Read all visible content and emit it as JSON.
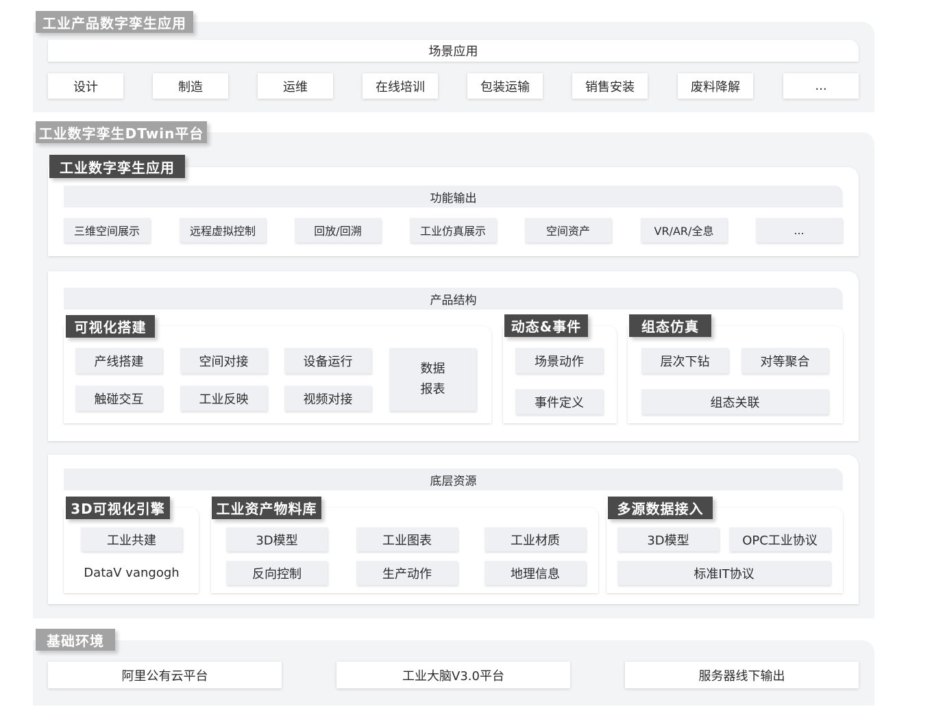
{
  "s1": {
    "title": "工业产品数字孪生应用",
    "bar": "场景应用",
    "items": [
      "设计",
      "制造",
      "运维",
      "在线培训",
      "包装运输",
      "销售安装",
      "废料降解",
      "..."
    ]
  },
  "s2": {
    "title": "工业数字孪生DTwin平台",
    "app_title": "工业数字孪生应用",
    "func": {
      "bar": "功能输出",
      "items": [
        "三维空间展示",
        "远程虚拟控制",
        "回放/回溯",
        "工业仿真展示",
        "空间资产",
        "VR/AR/全息",
        "..."
      ]
    },
    "prod": {
      "bar": "产品结构",
      "vis": {
        "title": "可视化搭建",
        "items": [
          "产线搭建",
          "空间对接",
          "设备运行",
          "触碰交互",
          "工业反映",
          "视频对接"
        ],
        "report_line1": "数据",
        "report_line2": "报表"
      },
      "dyn": {
        "title": "动态&事件",
        "items": [
          "场景动作",
          "事件定义"
        ]
      },
      "sim": {
        "title": "组态仿真",
        "items": [
          "层次下钻",
          "对等聚合",
          "组态关联"
        ]
      }
    },
    "base": {
      "bar": "底层资源",
      "engine": {
        "title": "3D可视化引擎",
        "items": [
          "工业共建",
          "DataV vangogh"
        ]
      },
      "lib": {
        "title": "工业资产物料库",
        "items": [
          "3D模型",
          "工业图表",
          "工业材质",
          "反向控制",
          "生产动作",
          "地理信息"
        ]
      },
      "multi": {
        "title": "多源数据接入",
        "items": [
          "3D模型",
          "OPC工业协议",
          "标准IT协议"
        ]
      }
    }
  },
  "s3": {
    "title": "基础环境",
    "items": [
      "阿里公有云平台",
      "工业大脑V3.0平台",
      "服务器线下输出"
    ]
  }
}
